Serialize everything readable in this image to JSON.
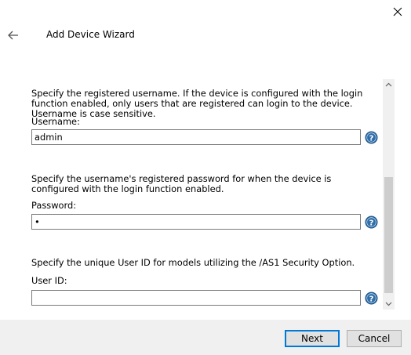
{
  "window": {
    "title": "Add Device Wizard"
  },
  "username": {
    "description": "Specify the registered username. If the device is configured with the login function enabled, only users that are registered can login to the device. Username is case sensitive.",
    "label": "Username:",
    "value": "admin"
  },
  "password": {
    "description": "Specify the username's registered password for when the device is configured with the login function enabled.",
    "label": "Password:",
    "value": "•"
  },
  "user_id": {
    "description": "Specify the unique User ID for models utilizing the /AS1 Security Option.",
    "label": "User ID:",
    "value": ""
  },
  "buttons": {
    "next": "Next",
    "cancel": "Cancel"
  },
  "icons": {
    "close": "close-icon",
    "back": "back-arrow-icon",
    "help": "help-icon"
  },
  "colors": {
    "help_blue": "#2f6ea8",
    "accent": "#0078d7"
  }
}
